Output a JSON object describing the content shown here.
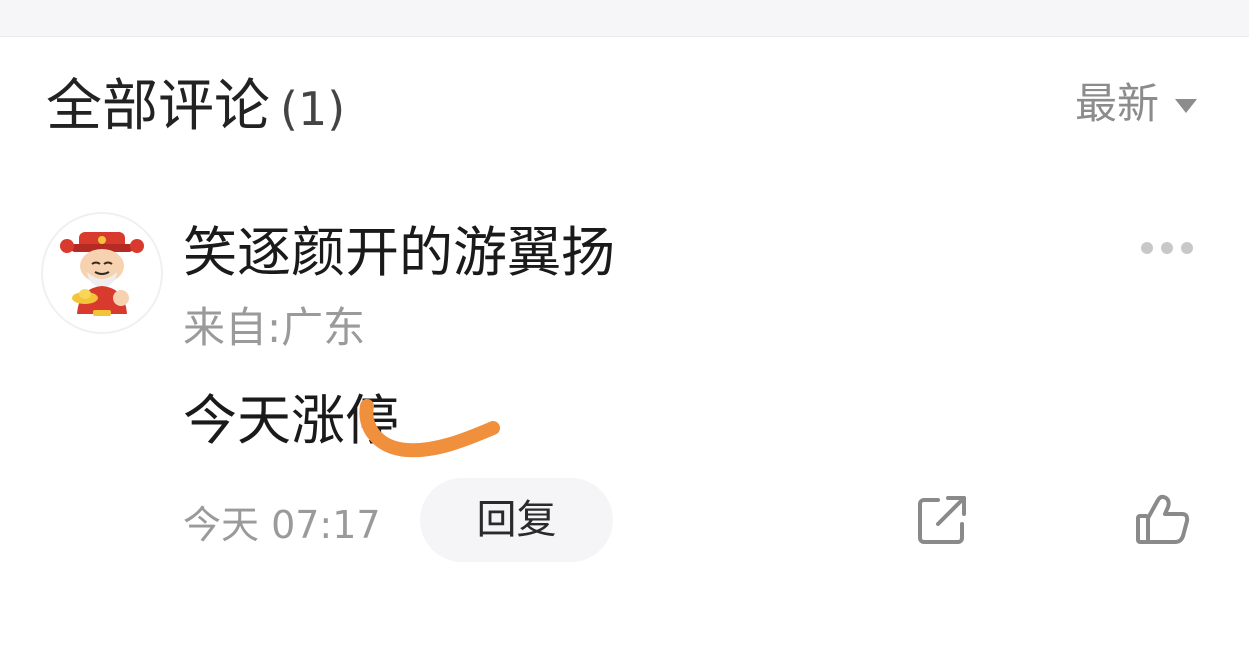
{
  "header": {
    "title": "全部评论",
    "count": "(1)",
    "sort_label": "最新"
  },
  "comment": {
    "username": "笑逐颜开的游翼扬",
    "location": "来自:广东",
    "text": "今天涨停",
    "time": "今天 07:17",
    "reply_label": "回复"
  },
  "colors": {
    "annotation_stroke": "#f0903c",
    "muted_text": "#9a9a9a",
    "primary_text": "#1a1a1a"
  },
  "icons": {
    "avatar": "cartoon-god-of-wealth-avatar",
    "more": "more-dots-icon",
    "share": "share-external-icon",
    "like": "thumbs-up-icon",
    "sort": "triangle-down-icon"
  }
}
